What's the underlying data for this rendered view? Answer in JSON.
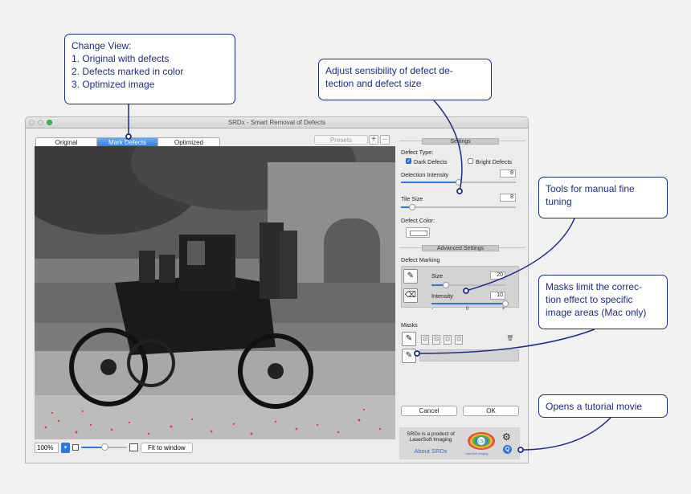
{
  "window": {
    "title": "SRDx - Smart Removal of Defects"
  },
  "view_tabs": [
    {
      "label": "Original",
      "active": false
    },
    {
      "label": "Mark Defects",
      "active": true
    },
    {
      "label": "Optimized",
      "active": false
    }
  ],
  "presets": {
    "label": "Presets",
    "add": "+",
    "remove": "–"
  },
  "settings": {
    "header": "Settings",
    "defect_type_label": "Defect Type:",
    "dark_defects": {
      "label": "Dark Defects",
      "checked": true
    },
    "bright_defects": {
      "label": "Bright Defects",
      "checked": false
    },
    "detection_intensity": {
      "label": "Detection Intensity",
      "value": "8",
      "level": 0.5
    },
    "tile_size": {
      "label": "Tile Size",
      "value": "8",
      "level": 0.1
    },
    "defect_color_label": "Defect Color:"
  },
  "advanced": {
    "header": "Advanced Settings",
    "defect_marking_label": "Defect Marking",
    "size": {
      "label": "Size",
      "value": "20",
      "level": 0.2
    },
    "intensity": {
      "label": "Intensity",
      "value": "10",
      "level": 1.0,
      "min_label": "-",
      "mid_label": "0",
      "max_label": "+"
    },
    "masks_label": "Masks"
  },
  "actions": {
    "cancel": "Cancel",
    "ok": "OK"
  },
  "info": {
    "text": "SRDx is a product of LaserSoft Imaging",
    "about": "About SRDx",
    "logo_text": "LSI",
    "logo_sub": "LaserSoft Imaging"
  },
  "bottom": {
    "zoom": "100%",
    "zoom_level": 0.5,
    "fit": "Fit to window"
  },
  "callouts": {
    "change_view": [
      "Change View:",
      "1. Original with defects",
      "2. Defects marked in color",
      "3. Optimized image"
    ],
    "sensibility": [
      "Adjust sensibility of defect de-",
      "tection and defect size"
    ],
    "tools": [
      "Tools for manual fine",
      "tuning"
    ],
    "masks": [
      "Masks limit the correc-",
      "tion effect to specific",
      "image areas (Mac only)"
    ],
    "tutorial": [
      "Opens a tutorial movie"
    ]
  },
  "colors": {
    "accent": "#2a78e4",
    "callout": "#1d2a8a",
    "defect_mark": "#ff3b30"
  }
}
